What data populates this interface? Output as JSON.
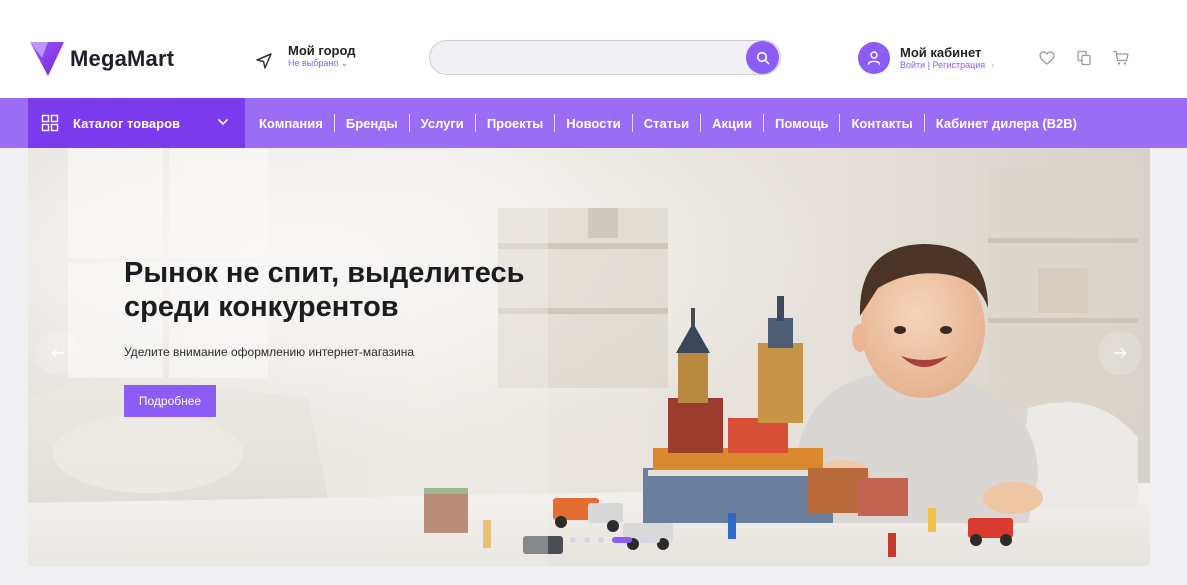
{
  "brand": {
    "name": "MegaMart",
    "accent": "#8b5cf6",
    "accent_dark": "#7c3aed",
    "nav_bg": "#9b6cf4"
  },
  "header": {
    "city": {
      "title": "Мой город",
      "subtitle": "Не выбрано",
      "icon": "location-arrow-icon"
    },
    "search": {
      "placeholder": "",
      "icon": "search-icon"
    },
    "account": {
      "title": "Мой кабинет",
      "subtitle": "Войти | Регистрация",
      "chevron": "›",
      "icon": "user-icon"
    },
    "icons": [
      "heart-icon",
      "compare-icon",
      "cart-icon"
    ]
  },
  "nav": {
    "catalog_label": "Каталог товаров",
    "items": [
      {
        "label": "Компания"
      },
      {
        "label": "Бренды"
      },
      {
        "label": "Услуги"
      },
      {
        "label": "Проекты"
      },
      {
        "label": "Новости"
      },
      {
        "label": "Статьи"
      },
      {
        "label": "Акции"
      },
      {
        "label": "Помощь"
      },
      {
        "label": "Контакты"
      },
      {
        "label": "Кабинет дилера (B2B)"
      }
    ]
  },
  "hero": {
    "title_line1": "Рынок не спит, выделитесь",
    "title_line2": "среди конкурентов",
    "subtitle": "Уделите внимание оформлению интернет-магазина",
    "button_label": "Подробнее",
    "slides_count": 6,
    "active_slide": 3
  }
}
